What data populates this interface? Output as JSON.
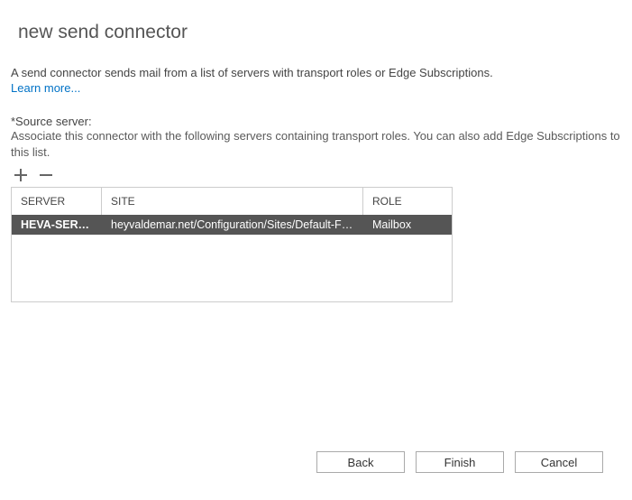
{
  "title": "new send connector",
  "description": "A send connector sends mail from a list of servers with transport roles or Edge Subscriptions.",
  "learn_more": "Learn more...",
  "source": {
    "label": "*Source server:",
    "help": "Associate this connector with the following servers containing transport roles. You can also add Edge Subscriptions to this list."
  },
  "table": {
    "columns": {
      "server": "SERVER",
      "site": "SITE",
      "role": "ROLE"
    },
    "rows": [
      {
        "server": "HEVA-SERVE...",
        "site": "heyvaldemar.net/Configuration/Sites/Default-First-...",
        "role": "Mailbox"
      }
    ]
  },
  "footer": {
    "back": "Back",
    "finish": "Finish",
    "cancel": "Cancel"
  }
}
